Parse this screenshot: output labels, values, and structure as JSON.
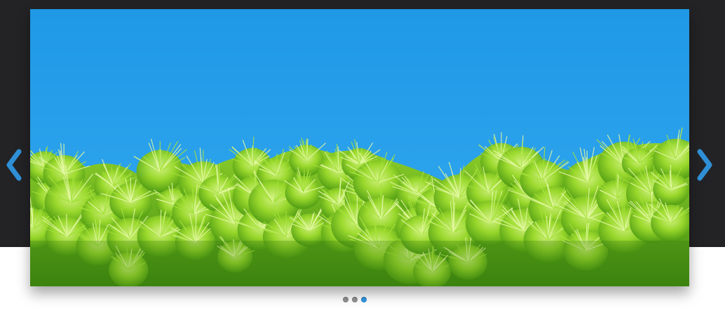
{
  "slider": {
    "active_slide": 3,
    "slide_count": 3,
    "accent_color": "#2f8fd6",
    "background_color": "#232326",
    "image": {
      "subject": "pine-branches-against-blue-sky",
      "sky_color": "#1f9ce8",
      "foliage_color": "#8fd62a"
    }
  },
  "controls": {
    "prev_icon": "chevron-left-icon",
    "next_icon": "chevron-right-icon"
  }
}
